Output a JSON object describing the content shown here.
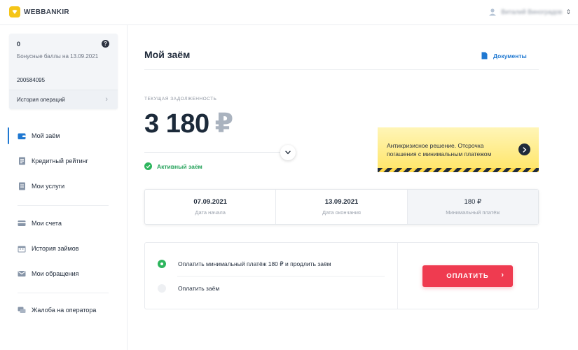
{
  "header": {
    "brand": "WEBBANKIR",
    "user_name": "Виталий Виноградов"
  },
  "sidebar": {
    "bonus_count": "0",
    "bonus_label": "Бонусные баллы на 13.09.2021",
    "account_number": "200584095",
    "history_link": "История операций",
    "items": [
      {
        "label": "Мой заём",
        "icon": "wallet-icon",
        "active": true
      },
      {
        "label": "Кредитный рейтинг",
        "icon": "rating-icon"
      },
      {
        "label": "Мои услуги",
        "icon": "services-icon"
      },
      {
        "label": "Мои счета",
        "icon": "cards-icon"
      },
      {
        "label": "История займов",
        "icon": "calendar-icon"
      },
      {
        "label": "Мои обращения",
        "icon": "mail-icon"
      },
      {
        "label": "Жалоба на оператора",
        "icon": "chat-icon"
      }
    ]
  },
  "main": {
    "title": "Мой заём",
    "documents_link": "Документы",
    "debt_label": "Текущая задолженность",
    "debt_amount": "3 180",
    "currency": "₽",
    "status": "Активный заём",
    "promo": {
      "text": "Антикризисное решение. Отсрочка погашения с минимальным платежом"
    },
    "dates": [
      {
        "value": "07.09.2021",
        "label": "Дата начала"
      },
      {
        "value": "13.09.2021",
        "label": "Дата окончания"
      },
      {
        "value": "180 ₽",
        "label": "Минимальный платёж"
      }
    ],
    "payment": {
      "option_min": "Оплатить минимальный платёж 180 ₽ и продлить заём",
      "option_full": "Оплатить заём",
      "selected": "option_min",
      "pay_button": "ОПЛАТИТЬ"
    }
  },
  "colors": {
    "accent_blue": "#1f78d1",
    "success_green": "#27a35c",
    "pay_red": "#ef3b50",
    "promo_yellow": "#ffe566"
  }
}
